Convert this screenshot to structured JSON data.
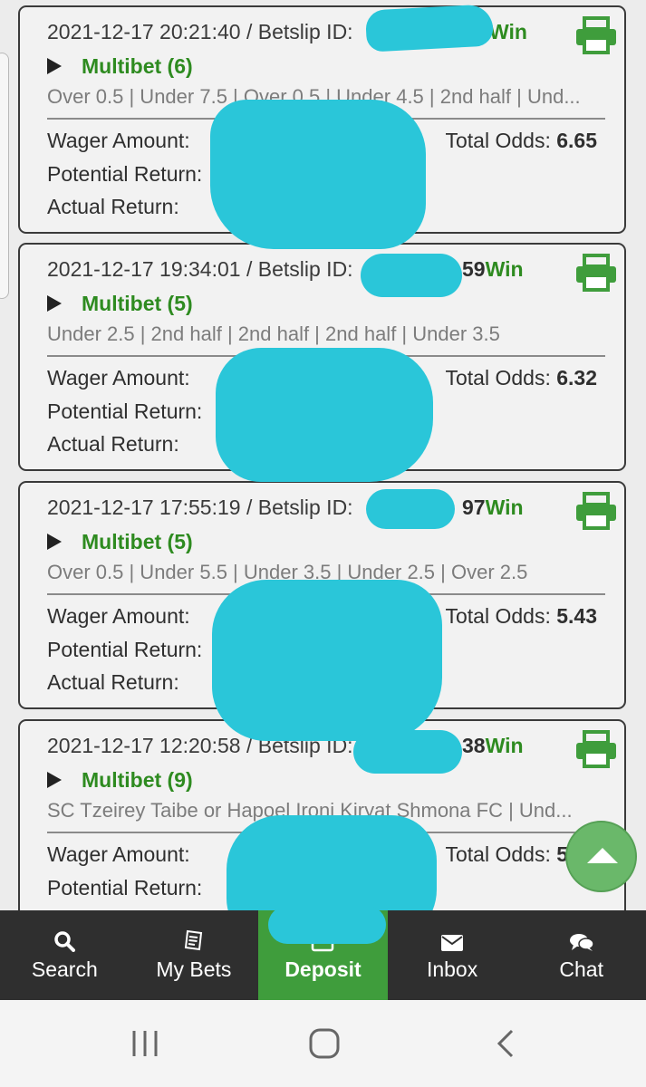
{
  "bets": [
    {
      "datetime": "2021-12-17 20:21:40",
      "betslip_label": "Betslip ID:",
      "status": "Win",
      "type": "Multibet (6)",
      "selections": "Over 0.5 | Under 7.5 | Over 0.5 | Under 4.5 | 2nd half | Und...",
      "wager_label": "Wager Amount:",
      "potential_label": "Potential Return:",
      "actual_label": "Actual Return:",
      "odds_label": "Total Odds:",
      "odds_value": "6.65"
    },
    {
      "datetime": "2021-12-17 19:34:01",
      "betslip_label": "Betslip ID:",
      "id_visible_tail": "59",
      "status": "Win",
      "type": "Multibet (5)",
      "selections": "Under 2.5 | 2nd half | 2nd half | 2nd half | Under 3.5",
      "wager_label": "Wager Amount:",
      "potential_label": "Potential Return:",
      "actual_label": "Actual Return:",
      "odds_label": "Total Odds:",
      "odds_value": "6.32"
    },
    {
      "datetime": "2021-12-17 17:55:19",
      "betslip_label": "Betslip ID:",
      "id_visible_tail": "97",
      "status": "Win",
      "type": "Multibet (5)",
      "selections": "Over 0.5 | Under 5.5 | Under 3.5 | Under 2.5 | Over 2.5",
      "wager_label": "Wager Amount:",
      "potential_label": "Potential Return:",
      "actual_label": "Actual Return:",
      "odds_label": "Total Odds:",
      "odds_value": "5.43"
    },
    {
      "datetime": "2021-12-17 12:20:58",
      "betslip_label": "Betslip ID:",
      "id_visible_tail": "38",
      "status": "Win",
      "type": "Multibet (9)",
      "selections": "SC Tzeirey Taibe or Hapoel Ironi Kiryat Shmona FC | Und...",
      "wager_label": "Wager Amount:",
      "potential_label": "Potential Return:",
      "odds_label": "Total Odds:",
      "odds_value": "5.19"
    }
  ],
  "nav": {
    "search": "Search",
    "my_bets": "My Bets",
    "deposit": "Deposit",
    "inbox": "Inbox",
    "chat": "Chat"
  },
  "colors": {
    "win_green": "#2e8b20",
    "deposit_green": "#3f9d3c",
    "nav_bg": "#2f2f2f",
    "redaction": "#2ac6d9"
  },
  "icons": {
    "print": "printer-icon",
    "search": "search-icon",
    "my_bets": "receipt-icon",
    "deposit": "wallet-icon",
    "inbox": "envelope-icon",
    "chat": "chat-bubbles-icon",
    "scroll_top": "chevron-up-icon"
  }
}
